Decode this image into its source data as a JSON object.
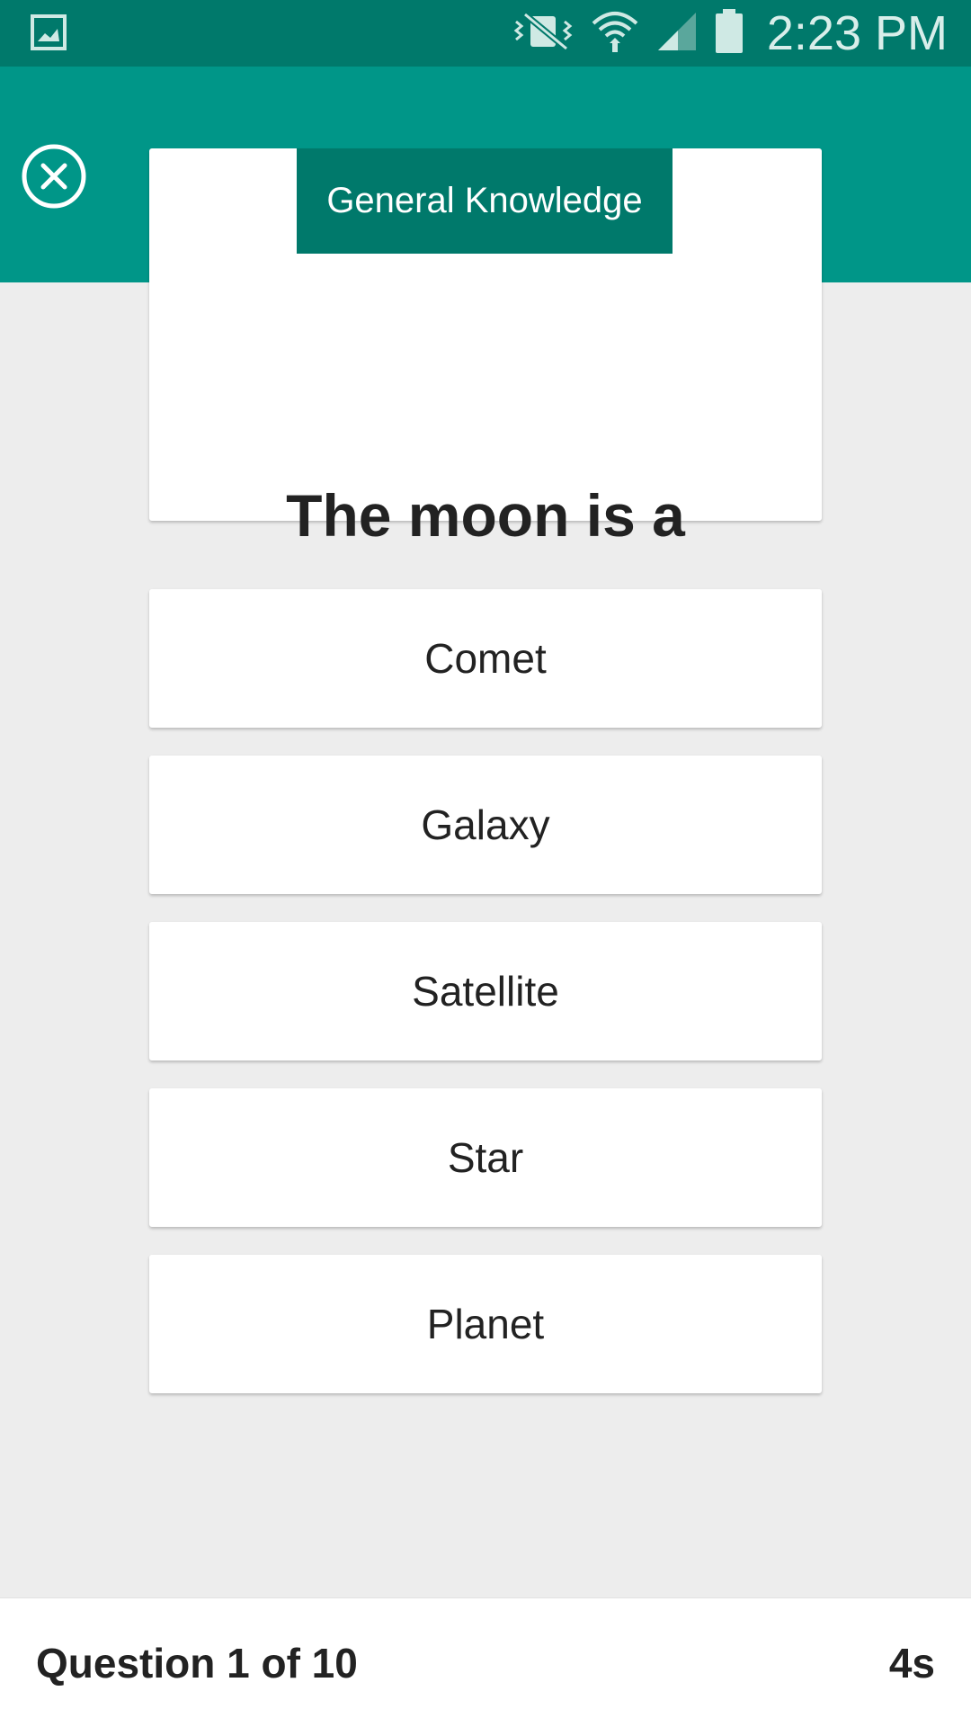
{
  "status_bar": {
    "time": "2:23 PM",
    "icons": [
      "image-icon",
      "vibrate-mute-icon",
      "wifi-icon",
      "cell-signal-icon",
      "battery-icon"
    ]
  },
  "header": {
    "close_icon": "close-circle-icon"
  },
  "question": {
    "category": "General Knowledge",
    "text": "The moon is a"
  },
  "answers": [
    {
      "label": "Comet"
    },
    {
      "label": "Galaxy"
    },
    {
      "label": "Satellite"
    },
    {
      "label": "Star"
    },
    {
      "label": "Planet"
    }
  ],
  "footer": {
    "progress": "Question 1 of 10",
    "timer": "4s"
  },
  "colors": {
    "status_bar": "#00796b",
    "header": "#009688",
    "category_tab": "#00796b",
    "background": "#ededed"
  }
}
